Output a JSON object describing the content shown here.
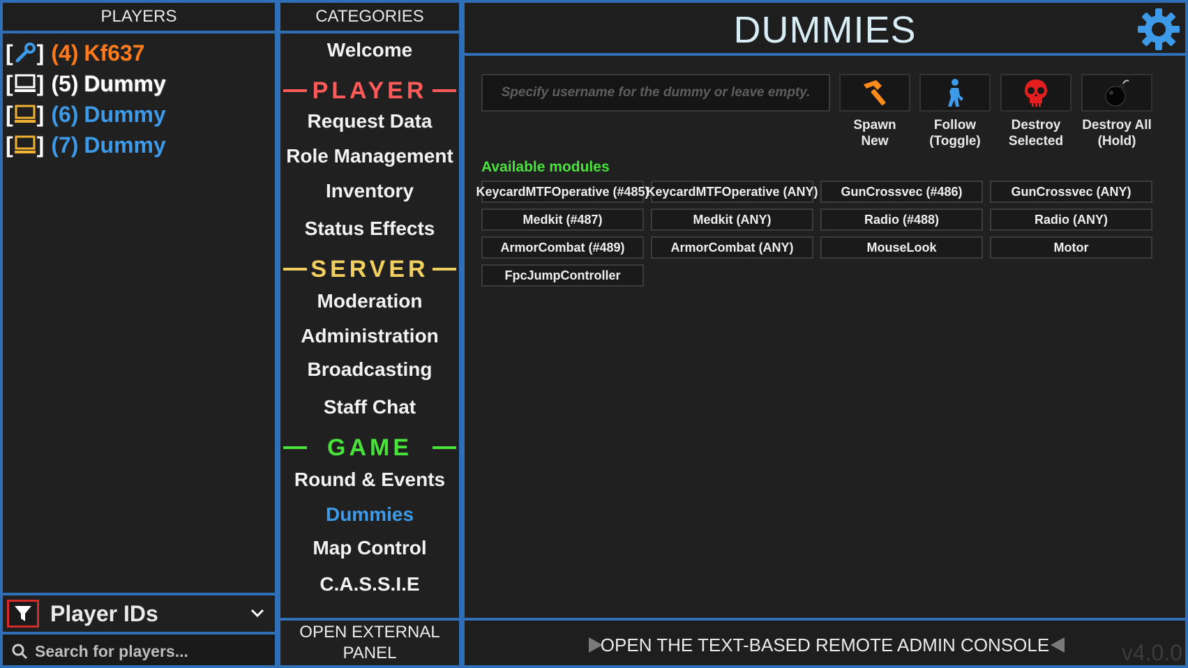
{
  "players": {
    "header": "PLAYERS",
    "list": [
      {
        "num": "(4)",
        "name": "Kf637",
        "icon": "wrench-icon",
        "color": "#ff7a1a"
      },
      {
        "num": "(5)",
        "name": "Dummy",
        "icon": "computer-icon",
        "color": "#ffffff"
      },
      {
        "num": "(6)",
        "name": "Dummy",
        "icon": "computer-icon",
        "color": "#3d9ae8"
      },
      {
        "num": "(7)",
        "name": "Dummy",
        "icon": "computer-icon",
        "color": "#3d9ae8"
      }
    ],
    "filter_label": "Player IDs",
    "search_placeholder": "Search for players..."
  },
  "categories": {
    "header": "CATEGORIES",
    "welcome": "Welcome",
    "sections": {
      "player": {
        "title": "PLAYER",
        "color": "#ff5a5a",
        "items": [
          "Request Data",
          "Role Management",
          "Inventory",
          "Status Effects"
        ]
      },
      "server": {
        "title": "SERVER",
        "color": "#f2d060",
        "items": [
          "Moderation",
          "Administration",
          "Broadcasting",
          "Staff Chat"
        ]
      },
      "game": {
        "title": "GAME",
        "color": "#48e23a",
        "items": [
          "Round & Events",
          "Dummies",
          "Map Control",
          "C.A.S.S.I.E"
        ]
      }
    },
    "active_item": "Dummies",
    "external_panel": "OPEN EXTERNAL PANEL"
  },
  "main": {
    "title": "DUMMIES",
    "username_placeholder": "Specify username for the dummy or leave empty.",
    "actions": [
      {
        "label_line1": "Spawn",
        "label_line2": "New",
        "icon": "hammer-icon"
      },
      {
        "label_line1": "Follow",
        "label_line2": "(Toggle)",
        "icon": "person-icon"
      },
      {
        "label_line1": "Destroy",
        "label_line2": "Selected",
        "icon": "skull-icon"
      },
      {
        "label_line1": "Destroy All",
        "label_line2": "(Hold)",
        "icon": "bomb-icon"
      }
    ],
    "modules_title": "Available modules",
    "modules": [
      "KeycardMTFOperative (#485)",
      "KeycardMTFOperative (ANY)",
      "GunCrossvec (#486)",
      "GunCrossvec (ANY)",
      "Medkit (#487)",
      "Medkit (ANY)",
      "Radio (#488)",
      "Radio (ANY)",
      "ArmorCombat (#489)",
      "ArmorCombat (ANY)",
      "MouseLook",
      "Motor",
      "FpcJumpController"
    ],
    "console_label": "OPEN THE TEXT-BASED REMOTE ADMIN CONSOLE",
    "version": "v4.0.0"
  },
  "colors": {
    "border": "#2e6fb8",
    "accent_blue": "#3d9ae8",
    "modules_green": "#48e23a"
  }
}
